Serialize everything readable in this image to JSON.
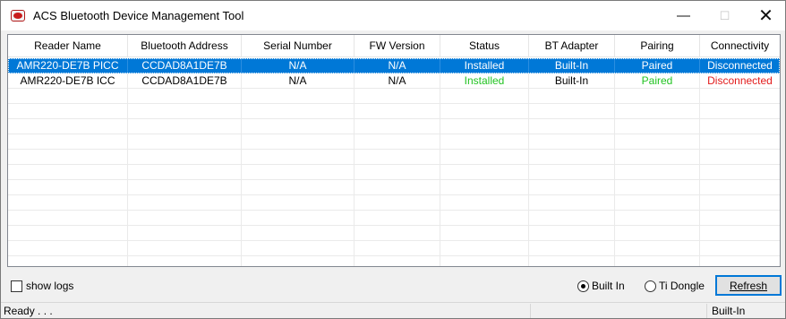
{
  "window": {
    "title": "ACS Bluetooth Device Management Tool",
    "minimize_glyph": "—",
    "maximize_glyph": "☐",
    "close_glyph": "✕",
    "icon": "acs-logo-icon"
  },
  "table": {
    "columns": [
      "Reader Name",
      "Bluetooth Address",
      "Serial Number",
      "FW Version",
      "Status",
      "BT Adapter",
      "Pairing",
      "Connectivity"
    ],
    "rows": [
      [
        "AMR220-DE7B PICC",
        "CCDAD8A1DE7B",
        "N/A",
        "N/A",
        "Installed",
        "Built-In",
        "Paired",
        "Disconnected"
      ],
      [
        "AMR220-DE7B ICC",
        "CCDAD8A1DE7B",
        "N/A",
        "N/A",
        "Installed",
        "Built-In",
        "Paired",
        "Disconnected"
      ]
    ],
    "selected_row": 0
  },
  "colors": {
    "selection": "#0078d7",
    "installed": "#22c322",
    "paired": "#22c322",
    "disconnected": "#e21b1b"
  },
  "controls": {
    "show_logs_label": "show logs",
    "show_logs_checked": false,
    "adapter_options": [
      "Built In",
      "Ti Dongle"
    ],
    "adapter_selected": "Built In",
    "refresh_label": "Refresh"
  },
  "status": {
    "left": "Ready . . .",
    "right": "Built-In"
  }
}
